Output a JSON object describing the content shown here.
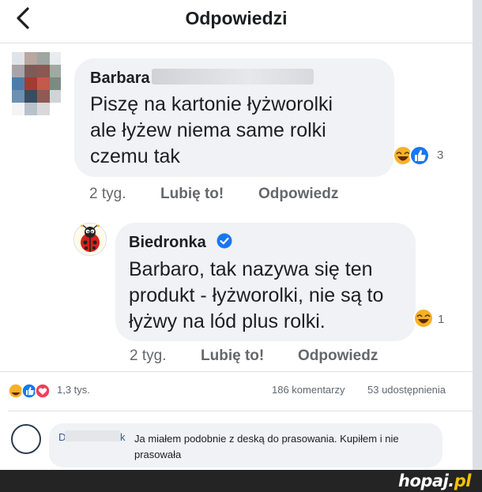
{
  "header": {
    "title": "Odpowiedzi"
  },
  "comment1": {
    "author": "Barbara",
    "text_lines": [
      "Piszę na kartonie łyżworolki",
      "ale łyżew niema same rolki",
      "czemu tak"
    ],
    "reaction_count": "3",
    "time": "2 tyg.",
    "like_label": "Lubię to!",
    "reply_label": "Odpowiedz"
  },
  "reply": {
    "author": "Biedronka",
    "text_lines": [
      "Barbaro, tak nazywa się ten",
      "produkt - łyżworolki, nie są to",
      "łyżwy na lód plus rolki."
    ],
    "reaction_count": "1",
    "time": "2 tyg.",
    "like_label": "Lubię to!",
    "reply_label": "Odpowiedz"
  },
  "post_stats": {
    "reactions": "1,3 tys.",
    "comments": "186 komentarzy",
    "shares": "53 udostępnienia"
  },
  "comment2": {
    "author_first": "D",
    "author_last": "k",
    "text": "Ja miałem podobnie z deską do prasowania. Kupiłem i nie prasowała"
  },
  "footer": {
    "brand": "hopaj",
    "dot": ".",
    "tld": "pl"
  },
  "colors": {
    "facebook_blue": "#1877f2",
    "love_red": "#f33e58",
    "haha_yellow": "#f7b125",
    "bubble": "#f0f2f5"
  }
}
